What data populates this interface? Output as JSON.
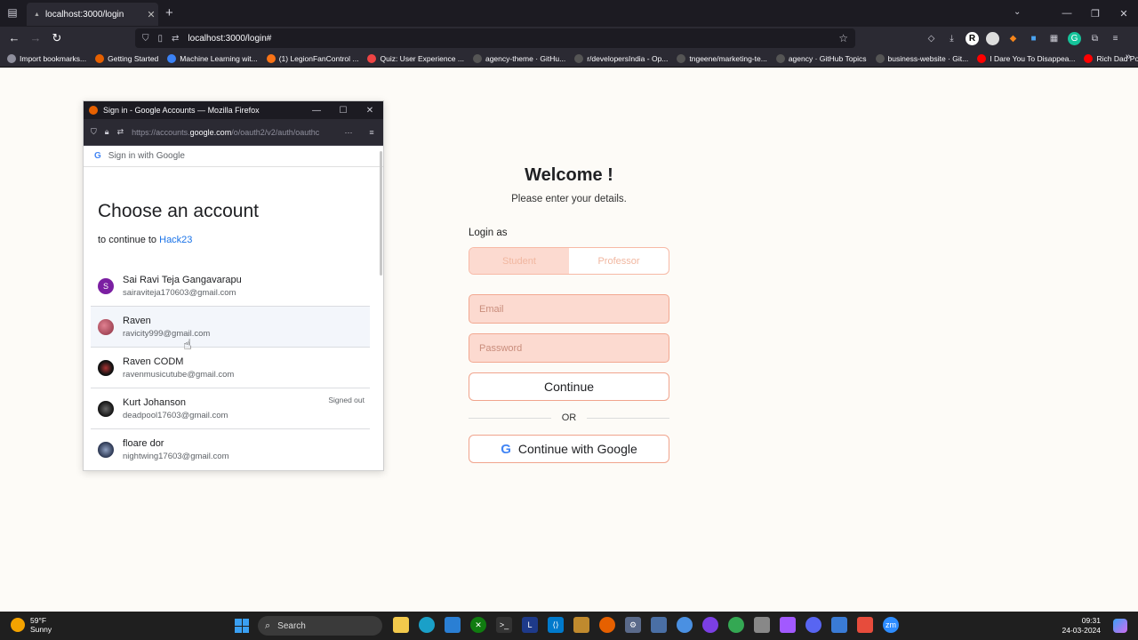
{
  "browser": {
    "tab_title": "localhost:3000/login",
    "url": "localhost:3000/login#",
    "bookmarks": [
      {
        "label": "Import bookmarks...",
        "color": "#8f8f9d"
      },
      {
        "label": "Getting Started",
        "color": "#e66000"
      },
      {
        "label": "Machine Learning wit...",
        "color": "#3b82f6"
      },
      {
        "label": "(1) LegionFanControl ...",
        "color": "#f97316"
      },
      {
        "label": "Quiz: User Experience ...",
        "color": "#ef4444"
      },
      {
        "label": "agency-theme · GitHu...",
        "color": "#444"
      },
      {
        "label": "r/developersIndia - Op...",
        "color": "#555"
      },
      {
        "label": "tngeene/marketing-te...",
        "color": "#444"
      },
      {
        "label": "agency · GitHub Topics",
        "color": "#444"
      },
      {
        "label": "business-website · Git...",
        "color": "#444"
      },
      {
        "label": "I Dare You To Disappea...",
        "color": "#ff0000"
      },
      {
        "label": "Rich Dad Poor Dad by ...",
        "color": "#ff0000"
      }
    ]
  },
  "popup": {
    "window_title": "Sign in - Google Accounts — Mozilla Firefox",
    "url_prefix": "https://accounts.",
    "url_domain": "google.com",
    "url_suffix": "/o/oauth2/v2/auth/oauthc",
    "sign_in_with": "Sign in with Google",
    "title": "Choose an account",
    "subtitle_prefix": "to continue to",
    "app_name": "Hack23",
    "accounts": [
      {
        "name": "Sai Ravi Teja Gangavarapu",
        "email": "sairaviteja170603@gmail.com",
        "status": "",
        "initial": "S",
        "color": "#7b1fa2"
      },
      {
        "name": "Raven",
        "email": "ravicity999@gmail.com",
        "status": "",
        "initial": "",
        "color": "#c2606b"
      },
      {
        "name": "Raven CODM",
        "email": "ravenmusicutube@gmail.com",
        "status": "",
        "initial": "",
        "color": "#222222"
      },
      {
        "name": "Kurt Johanson",
        "email": "deadpool17603@gmail.com",
        "status": "Signed out",
        "initial": "",
        "color": "#333333"
      },
      {
        "name": "floare dor",
        "email": "nightwing17603@gmail.com",
        "status": "",
        "initial": "",
        "color": "#4a5a7a"
      }
    ]
  },
  "login": {
    "title": "Welcome !",
    "subtitle": "Please enter your details.",
    "login_as": "Login as",
    "role_student": "Student",
    "role_professor": "Professor",
    "email_placeholder": "Email",
    "password_placeholder": "Password",
    "continue_label": "Continue",
    "or_label": "OR",
    "google_label": "Continue with Google"
  },
  "taskbar": {
    "temp": "59°F",
    "weather": "Sunny",
    "search": "Search",
    "time": "09:31",
    "date": "24-03-2024"
  }
}
